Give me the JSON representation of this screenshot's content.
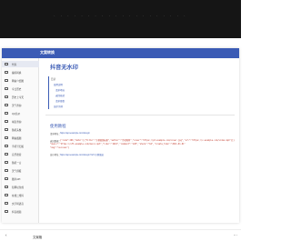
{
  "hero": {
    "caption": "· · · · · · · · · · · · · · · · · · · ·"
  },
  "window": {
    "title": "文案转换"
  },
  "sidebar": {
    "items": [
      {
        "label": "代码",
        "icon": "code-icon",
        "active": true
      },
      {
        "label": "编码转换",
        "icon": "transform-icon"
      },
      {
        "label": "网站介绍图",
        "icon": "image-icon"
      },
      {
        "label": "今日历史",
        "icon": "calendar-icon"
      },
      {
        "label": "历史上今天",
        "icon": "history-icon"
      },
      {
        "label": "天气查询",
        "icon": "weather-icon"
      },
      {
        "label": "QQ估价",
        "icon": "qq-icon"
      },
      {
        "label": "域名查询",
        "icon": "domain-icon"
      },
      {
        "label": "随机头像",
        "icon": "avatar-icon"
      },
      {
        "label": "网站截图",
        "icon": "screenshot-icon"
      },
      {
        "label": "手机号归属",
        "icon": "phone-icon"
      },
      {
        "label": "音乐搜索",
        "icon": "music-icon"
      },
      {
        "label": "随机一言",
        "icon": "quote-icon"
      },
      {
        "label": "天气预报",
        "icon": "forecast-icon"
      },
      {
        "label": "图片API",
        "icon": "picture-icon"
      },
      {
        "label": "短网址生成",
        "icon": "link-icon"
      },
      {
        "label": "在线二维码",
        "icon": "qrcode-icon"
      },
      {
        "label": "文字转语音",
        "icon": "speech-icon"
      },
      {
        "label": "抖音视频",
        "icon": "video-icon"
      }
    ]
  },
  "main": {
    "title": "抖音无水印",
    "toc": {
      "heading": "目录",
      "items": [
        "使用说明",
        "请求地址",
        "返回格式",
        "请求参数",
        "演示示例"
      ]
    },
    "usage": {
      "title": "使用教程",
      "api_label": "请求地址：",
      "api_url": "https://api.example.com/douyin",
      "return_label": "返回数据：",
      "code_lines": [
        "{\"code\":200,\"data\":[{\"title\":\"示例视频标题\",\"author\":\"作者昵称\",\"cover\":\"https://p3.example.com/cover.jpg\",\"url\":\"https://v.example.com/video.mp4\"}]}",
        "\"music\":\"https://sf3.example.com/music.mp3\",\"like\":\"1024\",\"comment\":\"128\",\"share\":\"64\",\"create_time\":\"2021-01-01\"",
        "\"msg\":\"success\"}"
      ],
      "demo_label": "演示地址：",
      "demo_url": "https://api.example.com/douyin?url=示例链接"
    }
  },
  "bottombar": {
    "back_glyph": "‹",
    "title": "文案格",
    "menu_glyph": "⋯"
  },
  "colors": {
    "accent": "#3b5bb5",
    "hero": "#151515",
    "code": "#c0392b"
  }
}
